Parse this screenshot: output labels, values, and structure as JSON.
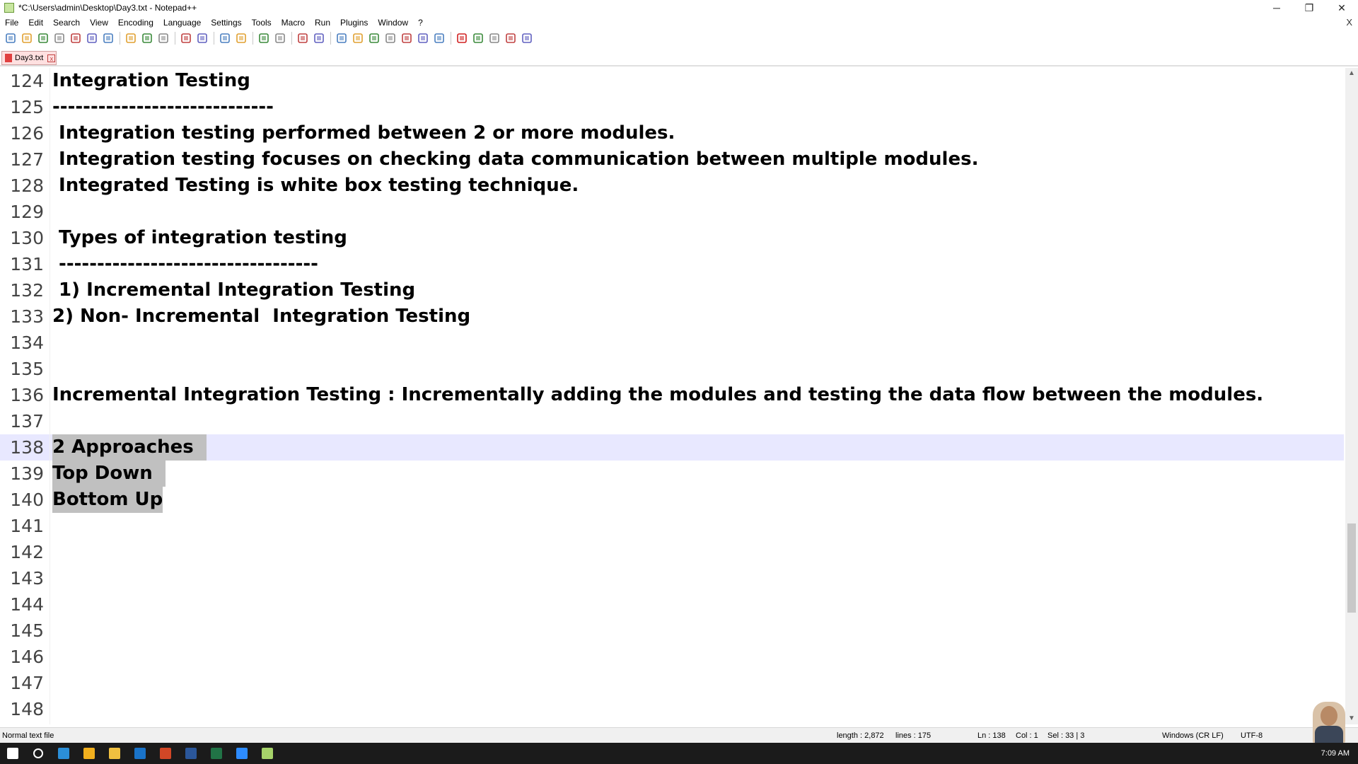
{
  "window": {
    "title": "*C:\\Users\\admin\\Desktop\\Day3.txt - Notepad++",
    "minimize": "─",
    "maximize": "❐",
    "close": "✕"
  },
  "menu": {
    "items": [
      "File",
      "Edit",
      "Search",
      "View",
      "Encoding",
      "Language",
      "Settings",
      "Tools",
      "Macro",
      "Run",
      "Plugins",
      "Window",
      "?"
    ],
    "close_doc": "X"
  },
  "toolbar": {
    "icons": [
      "new-file-icon",
      "open-file-icon",
      "save-icon",
      "save-all-icon",
      "close-icon",
      "close-all-icon",
      "print-icon",
      "cut-icon",
      "copy-icon",
      "paste-icon",
      "undo-icon",
      "redo-icon",
      "find-icon",
      "replace-icon",
      "zoom-in-icon",
      "zoom-out-icon",
      "sync-vertical-icon",
      "sync-horizontal-icon",
      "word-wrap-icon",
      "show-all-chars-icon",
      "indent-guide-icon",
      "doc-map-icon",
      "function-list-icon",
      "folder-workspace-icon",
      "monitoring-icon",
      "record-macro-icon",
      "stop-macro-icon",
      "play-macro-icon",
      "run-macro-multiple-icon",
      "save-macro-icon"
    ]
  },
  "tab": {
    "label": "Day3.txt",
    "close": "x"
  },
  "editor": {
    "lines": [
      {
        "num": "124",
        "text": "Integration Testing",
        "selected": false,
        "current": false
      },
      {
        "num": "125",
        "text": "-----------------------------",
        "selected": false,
        "current": false
      },
      {
        "num": "126",
        "text": " Integration testing performed between 2 or more modules.",
        "selected": false,
        "current": false
      },
      {
        "num": "127",
        "text": " Integration testing focuses on checking data communication between multiple modules.",
        "selected": false,
        "current": false
      },
      {
        "num": "128",
        "text": " Integrated Testing is white box testing technique.",
        "selected": false,
        "current": false
      },
      {
        "num": "129",
        "text": "",
        "selected": false,
        "current": false
      },
      {
        "num": "130",
        "text": " Types of integration testing",
        "selected": false,
        "current": false
      },
      {
        "num": "131",
        "text": " ----------------------------------",
        "selected": false,
        "current": false
      },
      {
        "num": "132",
        "text": " 1) Incremental Integration Testing",
        "selected": false,
        "current": false
      },
      {
        "num": "133",
        "text": "2) Non- Incremental  Integration Testing",
        "selected": false,
        "current": false
      },
      {
        "num": "134",
        "text": "",
        "selected": false,
        "current": false
      },
      {
        "num": "135",
        "text": "",
        "selected": false,
        "current": false
      },
      {
        "num": "136",
        "text": "Incremental Integration Testing : Incrementally adding the modules and testing the data flow between the modules.",
        "selected": false,
        "current": false
      },
      {
        "num": "137",
        "text": "",
        "selected": false,
        "current": false
      },
      {
        "num": "138",
        "text": "2 Approaches  ",
        "selected": true,
        "current": true
      },
      {
        "num": "139",
        "text": "Top Down  ",
        "selected": true,
        "current": false
      },
      {
        "num": "140",
        "text": "Bottom Up",
        "selected": true,
        "current": false
      },
      {
        "num": "141",
        "text": "",
        "selected": false,
        "current": false
      },
      {
        "num": "142",
        "text": "",
        "selected": false,
        "current": false
      },
      {
        "num": "143",
        "text": "",
        "selected": false,
        "current": false
      },
      {
        "num": "144",
        "text": "",
        "selected": false,
        "current": false
      },
      {
        "num": "145",
        "text": "",
        "selected": false,
        "current": false
      },
      {
        "num": "146",
        "text": "",
        "selected": false,
        "current": false
      },
      {
        "num": "147",
        "text": "",
        "selected": false,
        "current": false
      },
      {
        "num": "148",
        "text": "",
        "selected": false,
        "current": false
      }
    ]
  },
  "status": {
    "file_type": "Normal text file",
    "length": "length : 2,872",
    "lines": "lines : 175",
    "ln": "Ln : 138",
    "col": "Col : 1",
    "sel": "Sel : 33 | 3",
    "eol": "Windows (CR LF)",
    "encoding": "UTF-8"
  },
  "taskbar": {
    "icons": [
      "windows-start-icon",
      "search-icon",
      "edge-icon",
      "chrome-icon",
      "file-explorer-icon",
      "outlook-icon",
      "powerpoint-icon",
      "word-icon",
      "excel-icon",
      "zoom-icon",
      "notepadpp-icon"
    ],
    "colors": [
      "#ffffff",
      "#ffffff",
      "#2b8fd8",
      "#f2b01e",
      "#f0c040",
      "#1a73c8",
      "#d24726",
      "#2b579a",
      "#217346",
      "#2d8cff",
      "#a6d36a"
    ],
    "clock": "7:09 AM"
  }
}
